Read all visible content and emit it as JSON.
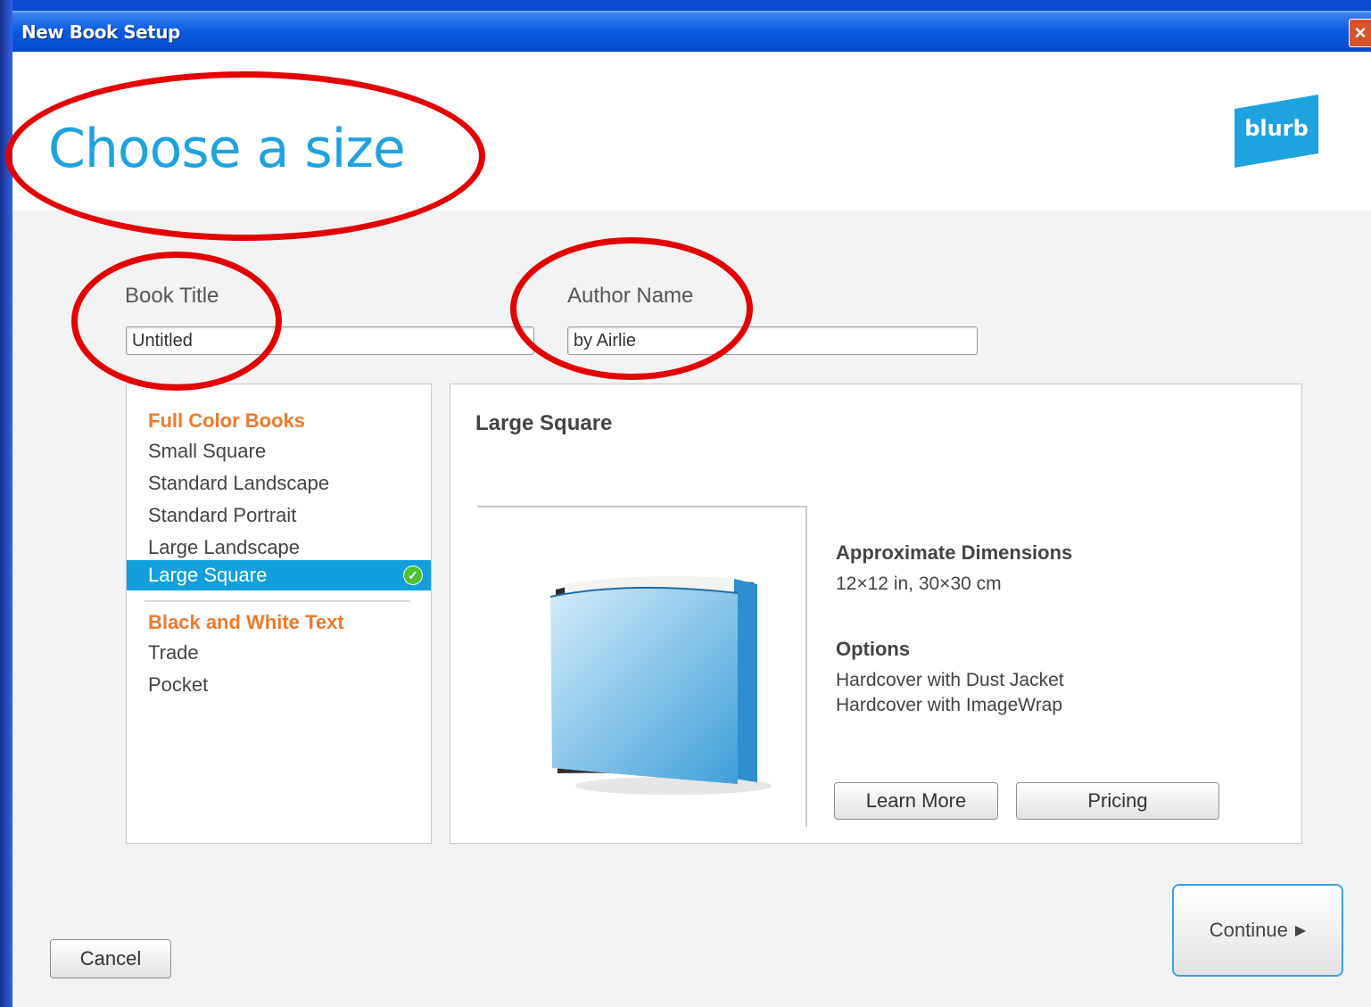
{
  "window": {
    "title": "New Book Setup",
    "close_icon": "close-icon"
  },
  "header": {
    "title": "Choose a size",
    "logo_text": "blurb",
    "accent_color": "#1ea3de"
  },
  "form": {
    "book_title_label": "Book Title",
    "book_title_value": "Untitled",
    "author_label": "Author Name",
    "author_value": "by Airlie"
  },
  "size_list": {
    "groups": [
      {
        "label": "Full Color Books",
        "items": [
          "Small Square",
          "Standard Landscape",
          "Standard Portrait",
          "Large Landscape",
          "Large Square"
        ]
      },
      {
        "label": "Black and White Text",
        "items": [
          "Trade",
          "Pocket"
        ]
      }
    ],
    "selected": "Large Square",
    "group_color": "#f07a2c",
    "selected_color": "#12a0dc"
  },
  "detail": {
    "title": "Large Square",
    "dimensions_heading": "Approximate Dimensions",
    "dimensions_value": "12×12 in, 30×30 cm",
    "options_heading": "Options",
    "options": [
      "Hardcover with Dust Jacket",
      "Hardcover with ImageWrap"
    ],
    "learn_more_label": "Learn More",
    "pricing_label": "Pricing"
  },
  "footer": {
    "continue_label": "Continue",
    "continue_icon": "arrow-right-icon",
    "cancel_label": "Cancel"
  },
  "annotation_color": "#e40000"
}
